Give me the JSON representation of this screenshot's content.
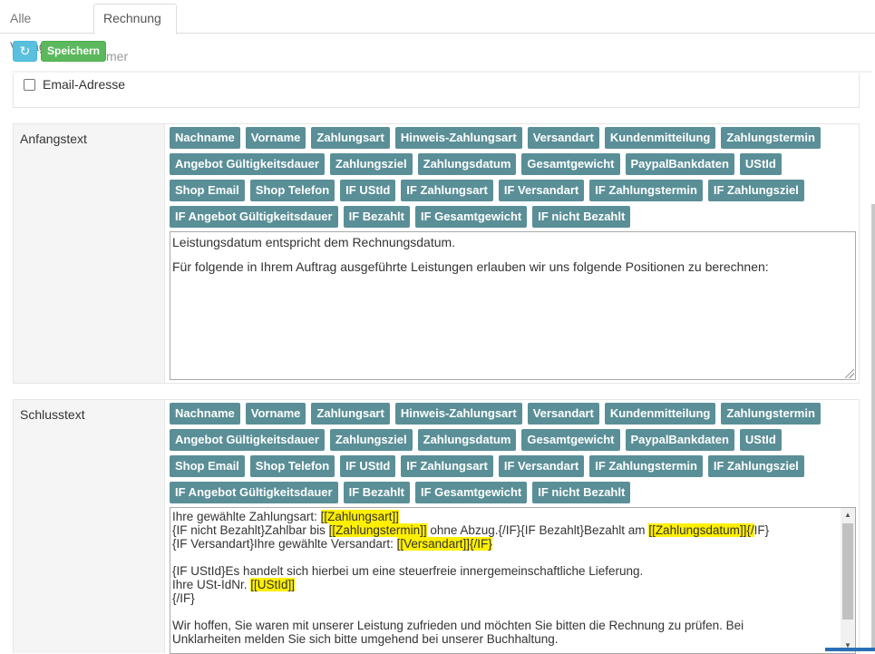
{
  "tabs": [
    {
      "label": "Alle Vorlagen",
      "active": false
    },
    {
      "label": "Rechnung",
      "active": true
    }
  ],
  "toolbar": {
    "refresh_icon": "↻",
    "save_label": "Speichern",
    "ghost_text": "mer"
  },
  "email": {
    "label": "Email-Adresse",
    "checked": false
  },
  "variables": [
    [
      "Nachname",
      "Vorname",
      "Zahlungsart",
      "Hinweis-Zahlungsart",
      "Versandart",
      "Kundenmitteilung",
      "Zahlungstermin"
    ],
    [
      "Angebot Gültigkeitsdauer",
      "Zahlungsziel",
      "Zahlungsdatum",
      "Gesamtgewicht",
      "PaypalBankdaten",
      "UStId"
    ],
    [
      "Shop Email",
      "Shop Telefon",
      "IF UStId",
      "IF Zahlungsart",
      "IF Versandart",
      "IF Zahlungstermin",
      "IF Zahlungsziel"
    ],
    [
      "IF Angebot Gültigkeitsdauer",
      "IF Bezahlt",
      "IF Gesamtgewicht",
      "IF nicht Bezahlt"
    ]
  ],
  "anfangstext": {
    "label": "Anfangstext",
    "lines": [
      "Leistungsdatum entspricht dem Rechnungsdatum.",
      "Für folgende in Ihrem Auftrag ausgeführte Leistungen erlauben wir uns folgende Positionen zu berechnen:"
    ]
  },
  "schlusstext": {
    "label": "Schlusstext",
    "l1a": "Ihre gewählte Zahlungsart: ",
    "l1h": "[[Zahlungsart]]",
    "l2a": "{IF nicht Bezahlt}Zahlbar bis ",
    "l2h1": "[[Zahlungstermin]]",
    "l2b": " ohne Abzug.{/IF}{IF Bezahlt}Bezahlt am ",
    "l2h2": "[[Zahlungsdatum]]{/",
    "l2c": "IF}",
    "l3a": "{IF Versandart}Ihre gewählte Versandart: ",
    "l3h": "[[Versandart]]{/IF}",
    "l4": "{IF UStId}Es handelt sich hierbei um eine steuerfreie innergemeinschaftliche Lieferung.",
    "l5a": "Ihre USt-IdNr. ",
    "l5h": "[[UStId]] ",
    "l6": "{/IF}",
    "l7": "Wir hoffen, Sie waren mit unserer Leistung zufrieden und möchten Sie bitten die Rechnung zu prüfen. Bei",
    "l8": "Unklarheiten melden Sie sich bitte umgehend bei unserer Buchhaltung."
  },
  "colors": {
    "variable_button": "#5a8f97",
    "save_button": "#5cb85c",
    "refresh_button": "#5bc0de",
    "highlight": "#ffef00"
  }
}
